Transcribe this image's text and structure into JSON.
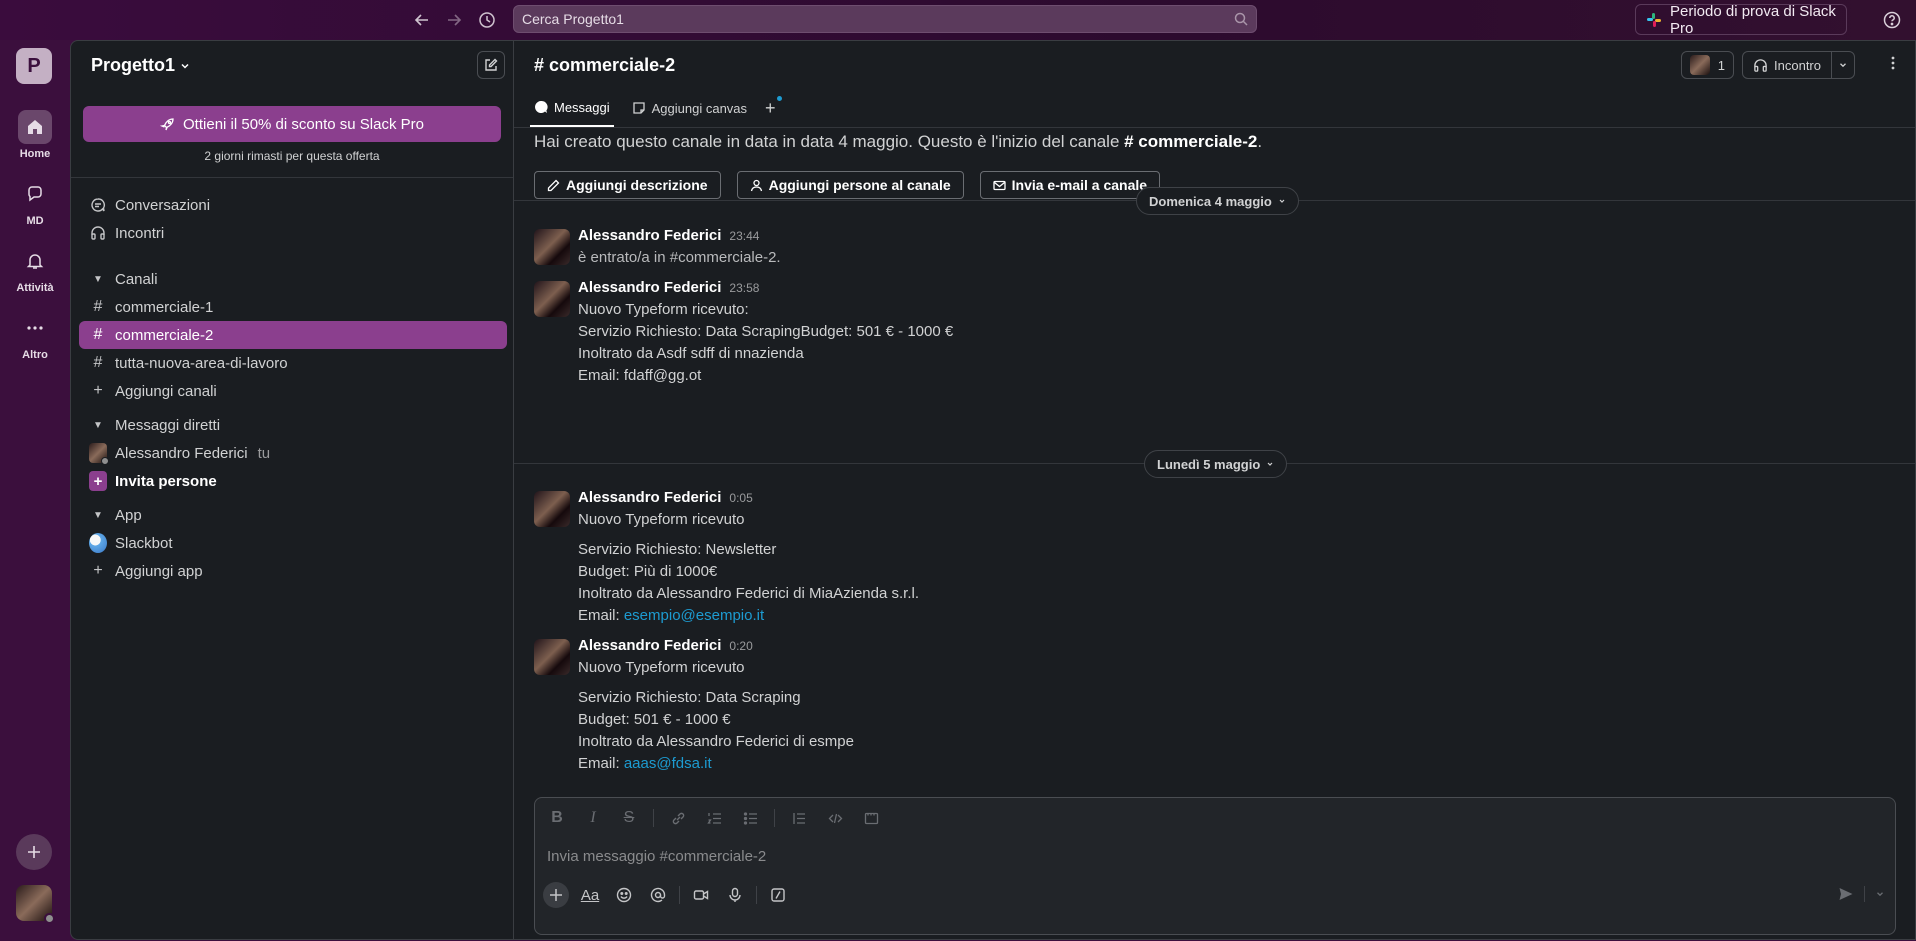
{
  "topbar": {
    "search_placeholder": "Cerca Progetto1",
    "trial_label": "Periodo di prova di Slack Pro"
  },
  "rail": {
    "workspace_initial": "P",
    "items": [
      {
        "label": "Home",
        "icon": "home-icon"
      },
      {
        "label": "MD",
        "icon": "dm-icon"
      },
      {
        "label": "Attività",
        "icon": "bell-icon"
      },
      {
        "label": "Altro",
        "icon": "more-icon"
      }
    ]
  },
  "sidebar": {
    "workspace_name": "Progetto1",
    "promo_label": "Ottieni il 50% di sconto su Slack Pro",
    "promo_sub": "2 giorni rimasti per questa offerta",
    "top_items": [
      "Conversazioni",
      "Incontri"
    ],
    "channels_header": "Canali",
    "channels": [
      "commerciale-1",
      "commerciale-2",
      "tutta-nuova-area-di-lavoro"
    ],
    "add_channels": "Aggiungi canali",
    "dm_header": "Messaggi diretti",
    "dm_user": "Alessandro Federici",
    "dm_you": "tu",
    "invite": "Invita persone",
    "apps_header": "App",
    "slackbot": "Slackbot",
    "add_app": "Aggiungi app"
  },
  "channel": {
    "title": "# commerciale-2",
    "member_count": "1",
    "huddle_label": "Incontro",
    "tabs": [
      "Messaggi",
      "Aggiungi canvas"
    ],
    "intro_prefix": "Hai creato questo canale in data in data 4 maggio. Questo è l'inizio del canale ",
    "intro_channel": "# commerciale-2",
    "intro_suffix": ".",
    "buttons": [
      "Aggiungi descrizione",
      "Aggiungi persone al canale",
      "Invia e-mail a canale"
    ],
    "dates": [
      "Domenica 4 maggio",
      "Lunedì 5 maggio"
    ]
  },
  "messages": [
    {
      "author": "Alessandro Federici",
      "time": "23:44",
      "lines": [
        "è entrato/a in #commerciale-2."
      ]
    },
    {
      "author": "Alessandro Federici",
      "time": "23:58",
      "lines": [
        "Nuovo Typeform ricevuto:",
        "Servizio Richiesto: Data ScrapingBudget: 501 € - 1000 €",
        "Inoltrato da Asdf sdff di nnazienda",
        "Email: fdaff@gg.ot"
      ]
    },
    {
      "author": "Alessandro Federici",
      "time": "0:05",
      "title": "Nuovo Typeform ricevuto",
      "lines": [
        "Servizio Richiesto: Newsletter",
        "Budget: Più di 1000€",
        "Inoltrato da Alessandro Federici di MiaAzienda s.r.l."
      ],
      "email_label": "Email: ",
      "email": "esempio@esempio.it"
    },
    {
      "author": "Alessandro Federici",
      "time": "0:20",
      "title": "Nuovo Typeform ricevuto",
      "lines": [
        "Servizio Richiesto: Data Scraping",
        "Budget: 501 € - 1000 €",
        "Inoltrato da Alessandro Federici di esmpe"
      ],
      "email_label": "Email: ",
      "email": "aaas@fdsa.it"
    }
  ],
  "composer": {
    "placeholder": "Invia messaggio #commerciale-2"
  },
  "colors": {
    "aubergine": "#3b0f3d",
    "accent": "#8b3f8e",
    "link": "#1d9bd1"
  }
}
